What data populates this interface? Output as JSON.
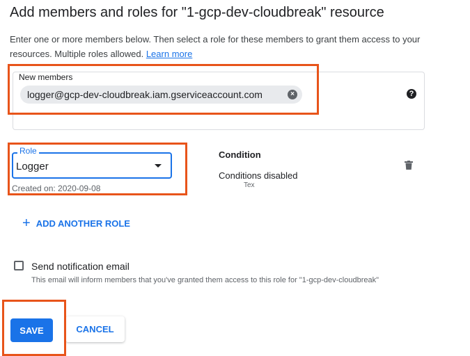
{
  "header": {
    "title": "Add members and roles for \"1-gcp-dev-cloudbreak\" resource",
    "description": "Enter one or more members below. Then select a role for these members to grant them access to your resources. Multiple roles allowed.",
    "learn_more": "Learn more"
  },
  "members": {
    "label": "New members",
    "chips": [
      "logger@gcp-dev-cloudbreak.iam.gserviceaccount.com"
    ],
    "help_icon": "?"
  },
  "role": {
    "label": "Role",
    "value": "Logger",
    "created": "Created on: 2020-09-08"
  },
  "condition": {
    "title": "Condition",
    "status": "Conditions disabled",
    "tooltip": "Tex"
  },
  "add_role": {
    "icon": "+",
    "label": "ADD ANOTHER ROLE"
  },
  "notification": {
    "checked": false,
    "label": "Send notification email",
    "subtext": "This email will inform members that you've granted them access to this role for \"1-gcp-dev-cloudbreak\""
  },
  "actions": {
    "save": "SAVE",
    "cancel": "CANCEL"
  },
  "colors": {
    "accent": "#1a73e8",
    "highlight": "#e8541a"
  }
}
